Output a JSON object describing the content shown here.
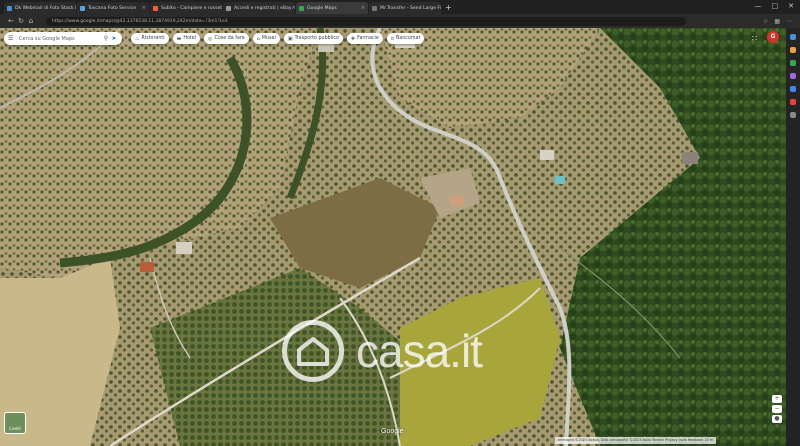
{
  "browser": {
    "tabs": [
      {
        "label": "Dk Webmail di Foto Stock FreeRi",
        "color": "#4a90d9",
        "active": false
      },
      {
        "label": "Toscana Foto Service",
        "color": "#5ba2e8",
        "active": false
      },
      {
        "label": "Subito - Campiere e rosseti gratis",
        "color": "#ff5a36",
        "active": false
      },
      {
        "label": "Accedi e registrati | eBay",
        "color": "#999999",
        "active": false
      },
      {
        "label": "Google Maps",
        "color": "#34a853",
        "active": true
      },
      {
        "label": "Mr.Transfer - Send Large Files A",
        "color": "#777777",
        "active": false
      }
    ],
    "new_tab_label": "+",
    "url": "https://www.google.it/maps/@42,1376538,11,3874919,242m/data=!3m1!1e3"
  },
  "maps": {
    "search_placeholder": "Cerca su Google Maps",
    "chips": [
      {
        "label": "Ristoranti",
        "icon": "fork-knife-icon"
      },
      {
        "label": "Hotel",
        "icon": "bed-icon"
      },
      {
        "label": "Cose da fare",
        "icon": "camera-icon"
      },
      {
        "label": "Musei",
        "icon": "museum-icon"
      },
      {
        "label": "Trasporto pubblico",
        "icon": "bus-icon"
      },
      {
        "label": "Farmacie",
        "icon": "pharmacy-icon"
      },
      {
        "label": "Bancomat",
        "icon": "atm-icon"
      }
    ],
    "account_initial": "G",
    "layers_label": "Livelli",
    "google_logo": "Google",
    "footer_text": "Immagini ©2023 Airbus, Dati cartografici ©2023   Italia   Termini   Privacy   Invia feedback   20 m"
  },
  "watermark": {
    "text": "casa.it"
  },
  "colors": {
    "accent": "#1a73e8",
    "avatar": "#d93025",
    "terrain": "#8a8a62"
  }
}
